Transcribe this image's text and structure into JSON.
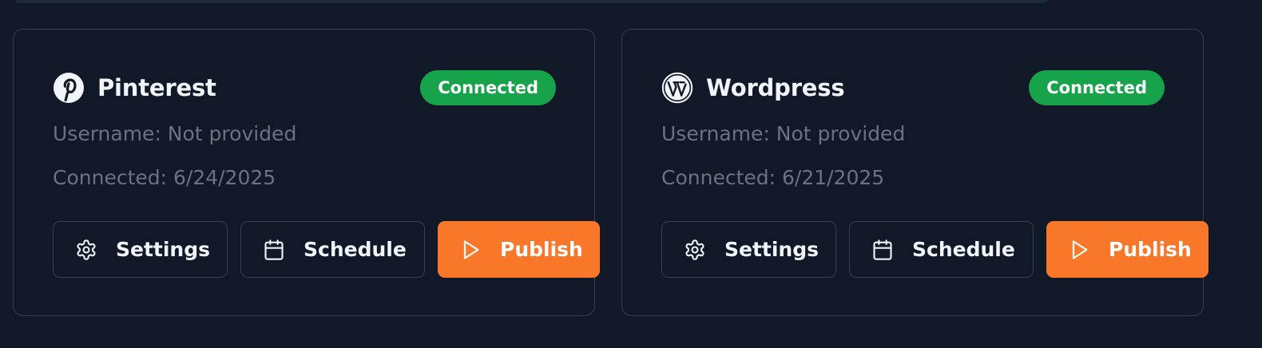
{
  "cards": [
    {
      "platform": "Pinterest",
      "platform_icon": "pinterest-icon",
      "status": "Connected",
      "status_color": "#16a34a",
      "username": "Username: Not provided",
      "connected": "Connected: 6/24/2025",
      "buttons": {
        "settings": "Settings",
        "schedule": "Schedule",
        "publish": "Publish"
      }
    },
    {
      "platform": "Wordpress",
      "platform_icon": "wordpress-icon",
      "status": "Connected",
      "status_color": "#16a34a",
      "username": "Username: Not provided",
      "connected": "Connected: 6/21/2025",
      "buttons": {
        "settings": "Settings",
        "schedule": "Schedule",
        "publish": "Publish"
      }
    }
  ],
  "icons": {
    "settings": "gear-icon",
    "schedule": "calendar-icon",
    "publish": "play-icon"
  },
  "colors": {
    "background": "#111827",
    "border": "#374151",
    "accent": "#f97729",
    "success": "#16a34a",
    "muted_text": "#6b7280"
  }
}
